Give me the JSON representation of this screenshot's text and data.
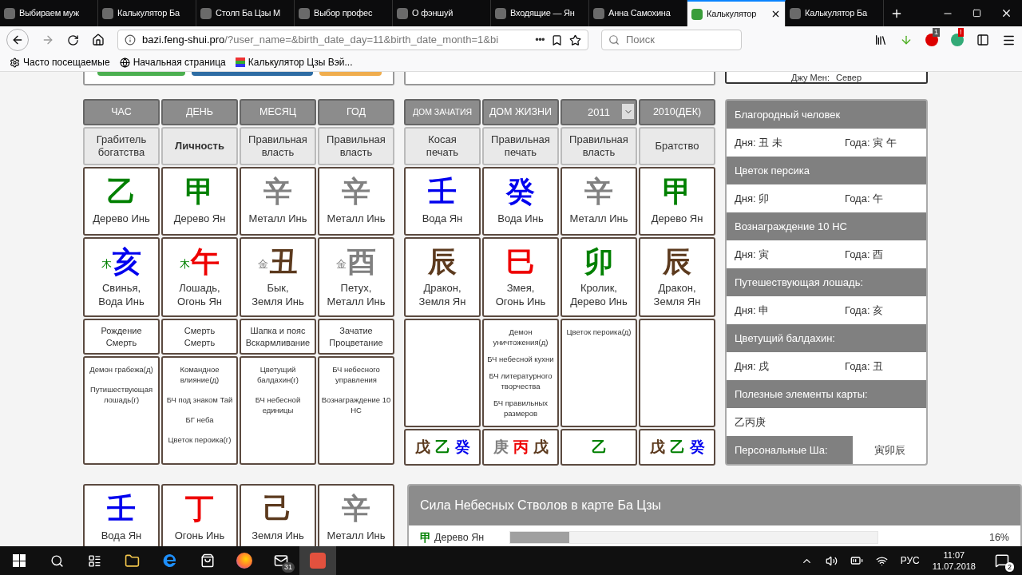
{
  "browser": {
    "tabs": [
      {
        "title": "Выбираем муж",
        "selected": false
      },
      {
        "title": "Калькулятор Ба",
        "selected": false
      },
      {
        "title": "Столп Ба Цзы М",
        "selected": false
      },
      {
        "title": "Выбор профес",
        "selected": false
      },
      {
        "title": "О фэншуй",
        "selected": false
      },
      {
        "title": "Входящие — Ян",
        "selected": false
      },
      {
        "title": "Анна Самохина",
        "selected": false
      },
      {
        "title": "Калькулятор",
        "selected": true
      },
      {
        "title": "Калькулятор Ба",
        "selected": false
      }
    ],
    "url_host": "bazi.feng-shui.pro",
    "url_path": "/?user_name=&birth_date_day=11&birth_date_month=1&bi",
    "more": "•••",
    "search_placeholder": "Поиск",
    "addon_badges": [
      "1",
      "!"
    ],
    "bookmarks": [
      "Часто посещаемые",
      "Начальная страница",
      "Калькулятор Цзы Вэй..."
    ]
  },
  "top_card": {
    "label": "Джу Мен:",
    "value": "Север"
  },
  "chart_main": [
    {
      "header": "ЧАС",
      "god": "Грабитель богатства",
      "day_master": false,
      "stem": {
        "char": "乙",
        "color": "#008000",
        "label": "Дерево Инь"
      },
      "branch": {
        "hidden": {
          "char": "木",
          "color": "#008000"
        },
        "char": "亥",
        "color": "#0000ee",
        "label": "Свинья,\nВода Инь"
      },
      "stages": "Рождение\nСмерть",
      "stars": [
        "Демон грабежа(д)",
        "Путишествующая лошадь(г)"
      ]
    },
    {
      "header": "ДЕНЬ",
      "god": "Личность",
      "day_master": true,
      "stem": {
        "char": "甲",
        "color": "#008000",
        "label": "Дерево Ян"
      },
      "branch": {
        "hidden": {
          "char": "木",
          "color": "#008000"
        },
        "char": "午",
        "color": "#ee0000",
        "label": "Лошадь,\nОгонь Ян"
      },
      "stages": "Смерть\nСмерть",
      "stars": [
        "Командное влияние(д)",
        "БЧ под знаком Тай",
        "БГ неба",
        "Цветок пероика(г)"
      ]
    },
    {
      "header": "МЕСЯЦ",
      "god": "Правильная власть",
      "day_master": false,
      "stem": {
        "char": "辛",
        "color": "#808080",
        "label": "Металл Инь"
      },
      "branch": {
        "hidden": {
          "char": "金",
          "color": "#808080"
        },
        "char": "丑",
        "color": "#5c3a1e",
        "label": "Бык,\nЗемля Инь"
      },
      "stages": "Шапка и пояс\nВскармливание",
      "stars": [
        "Цветущий балдахин(г)",
        "БЧ небесной единицы"
      ]
    },
    {
      "header": "ГОД",
      "god": "Правильная власть",
      "day_master": false,
      "stem": {
        "char": "辛",
        "color": "#808080",
        "label": "Металл Инь"
      },
      "branch": {
        "hidden": {
          "char": "金",
          "color": "#808080"
        },
        "char": "酉",
        "color": "#808080",
        "label": "Петух,\nМеталл Инь"
      },
      "stages": "Зачатие\nПроцветание",
      "stars": [
        "БЧ небесного управления",
        "Вознаграждение 10 НС"
      ]
    }
  ],
  "chart_extra": [
    {
      "header": "ДОМ ЗАЧАТИЯ",
      "kind": "label",
      "god": "Косая\nпечать",
      "stem": {
        "char": "壬",
        "color": "#0000ee",
        "label": "Вода Ян"
      },
      "branch": {
        "char": "辰",
        "color": "#5c3a1e",
        "label": "Дракон,\nЗемля Ян"
      },
      "hidden": [
        {
          "char": "戊",
          "color": "#5c3a1e"
        },
        {
          "char": "乙",
          "color": "#008000"
        },
        {
          "char": "癸",
          "color": "#0000ee"
        }
      ]
    },
    {
      "header": "ДОМ ЖИЗНИ",
      "kind": "label",
      "god": "Правильная\nпечать",
      "stem": {
        "char": "癸",
        "color": "#0000ee",
        "label": "Вода Инь"
      },
      "branch": {
        "char": "巳",
        "color": "#ee0000",
        "label": "Змея,\nОгонь Инь"
      },
      "stars": [
        "Демон уничтожения(д)",
        "БЧ небесной кухни",
        "БЧ литературного творчества",
        "БЧ правильных размеров"
      ],
      "hidden": [
        {
          "char": "庚",
          "color": "#808080"
        },
        {
          "char": "丙",
          "color": "#ee0000"
        },
        {
          "char": "戊",
          "color": "#5c3a1e"
        }
      ]
    },
    {
      "header": "2011",
      "kind": "select",
      "god": "Правильная\nвласть",
      "stem": {
        "char": "辛",
        "color": "#808080",
        "label": "Металл Инь"
      },
      "branch": {
        "char": "卯",
        "color": "#008000",
        "label": "Кролик,\nДерево Инь"
      },
      "stars": [
        "Цветок пероика(д)"
      ],
      "hidden": [
        {
          "char": "乙",
          "color": "#008000"
        }
      ]
    },
    {
      "header": "2010(ДЕК)",
      "kind": "label",
      "god": "Братство",
      "stem": {
        "char": "甲",
        "color": "#008000",
        "label": "Дерево Ян"
      },
      "branch": {
        "char": "辰",
        "color": "#5c3a1e",
        "label": "Дракон,\nЗемля Ян"
      },
      "hidden": [
        {
          "char": "戊",
          "color": "#5c3a1e"
        },
        {
          "char": "乙",
          "color": "#008000"
        },
        {
          "char": "癸",
          "color": "#0000ee"
        }
      ]
    }
  ],
  "stars_panel": {
    "sections": [
      {
        "title": "Благородный человек",
        "day_label": "Дня:",
        "day": "丑 未",
        "year_label": "Года:",
        "year": "寅 午"
      },
      {
        "title": "Цветок персика",
        "day_label": "Дня:",
        "day": "卯",
        "year_label": "Года:",
        "year": "午"
      },
      {
        "title": "Вознаграждение 10 НС",
        "day_label": "Дня:",
        "day": "寅",
        "year_label": "Года:",
        "year": "酉"
      },
      {
        "title": "Путешествующая лошадь:",
        "day_label": "Дня:",
        "day": "申",
        "year_label": "Года:",
        "year": "亥"
      },
      {
        "title": "Цветущий балдахин:",
        "day_label": "Дня:",
        "day": "戌",
        "year_label": "Года:",
        "year": "丑"
      }
    ],
    "useful_title": "Полезные элементы карты:",
    "useful": "乙丙庚",
    "sha_title": "Персональные Ша:",
    "sha": "寅卯辰"
  },
  "luck_stems": [
    {
      "char": "壬",
      "color": "#0000ee",
      "label": "Вода Ян"
    },
    {
      "char": "丁",
      "color": "#ee0000",
      "label": "Огонь Инь"
    },
    {
      "char": "己",
      "color": "#5c3a1e",
      "label": "Земля Инь"
    },
    {
      "char": "辛",
      "color": "#808080",
      "label": "Металл Инь"
    }
  ],
  "strength": {
    "title": "Сила Небесных Стволов в карте Ба Цзы",
    "rows": [
      {
        "char": "甲",
        "color": "#008000",
        "label": "Дерево Ян",
        "level": 0.16,
        "value": "16%"
      }
    ]
  },
  "taskbar": {
    "mail_badge": "31",
    "language": "РУС",
    "time": "11:07",
    "date": "11.07.2018",
    "notifications": "2"
  }
}
